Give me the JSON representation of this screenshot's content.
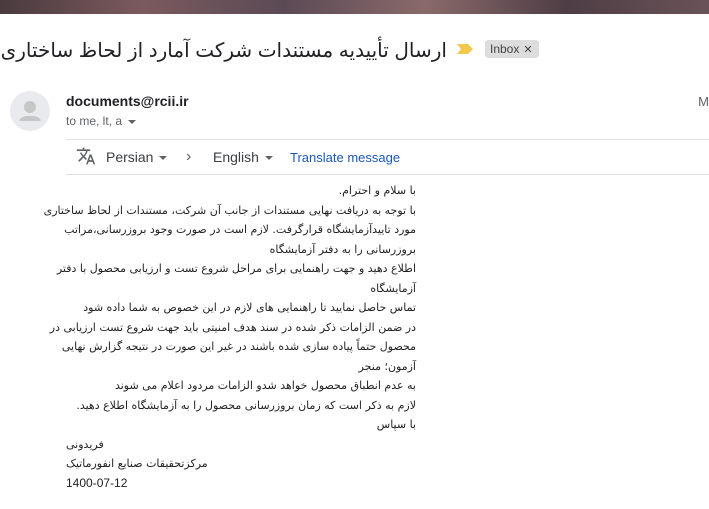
{
  "email": {
    "subject": "ارسال تأییدیه مستندات شرکت آمارد از لحاظ ساختاری",
    "label": "Inbox",
    "sender": "documents@rcii.ir",
    "recipients": "to me, lt, a",
    "edge_text": "M"
  },
  "translate": {
    "from_language": "Persian",
    "to_language": "English",
    "action_label": "Translate message"
  },
  "body_lines": [
    "با سلام و احترام.",
    "با توجه به دریافت نهایی مستندات از جانب آن شرکت، مستندات از لحاظ ساختاری",
    "مورد تاییدآزمایشگاه قرارگرفت. لازم است در صورت وجود بروزرسانی،مراتب",
    "بروزرسانی را به دفتر آزمایشگاه",
    "اطلاع دهید و جهت راهنمایی برای مراحل شروع تست و ارزیابی محصول با دفتر",
    "آزمایشگاه",
    "تماس حاصل نمایید تا راهنمایی های لازم در این خصوص به شما داده شود",
    "در ضمن الزامات ذکر شده در سند هدف امنیتی باید جهت شروع تست ارزیابی در",
    "محصول حتماً پیاده سازی شده باشند در غیر این صورت در نتیجه گزارش نهایی",
    "آزمون؛ منجر",
    "به عدم انطباق محصول خواهد شدو الزامات مردود اعلام می شوند",
    "لازم به ذکر است که زمان بروزرسانی محصول را به آزمایشگاه اطلاع دهید.",
    "با سپاس",
    "فریدونی",
    "مرکزتحقیقات صنایع انفورماتیک"
  ],
  "signature_date": "1400-07-12",
  "colors": {
    "link": "#1a57b7",
    "important_marker": "#f2c94c",
    "label_chip": "#dddddd"
  },
  "icons": [
    "important-marker-icon",
    "close-icon",
    "avatar-icon",
    "translate-icon",
    "chevron-right-icon",
    "caret-down-icon"
  ]
}
